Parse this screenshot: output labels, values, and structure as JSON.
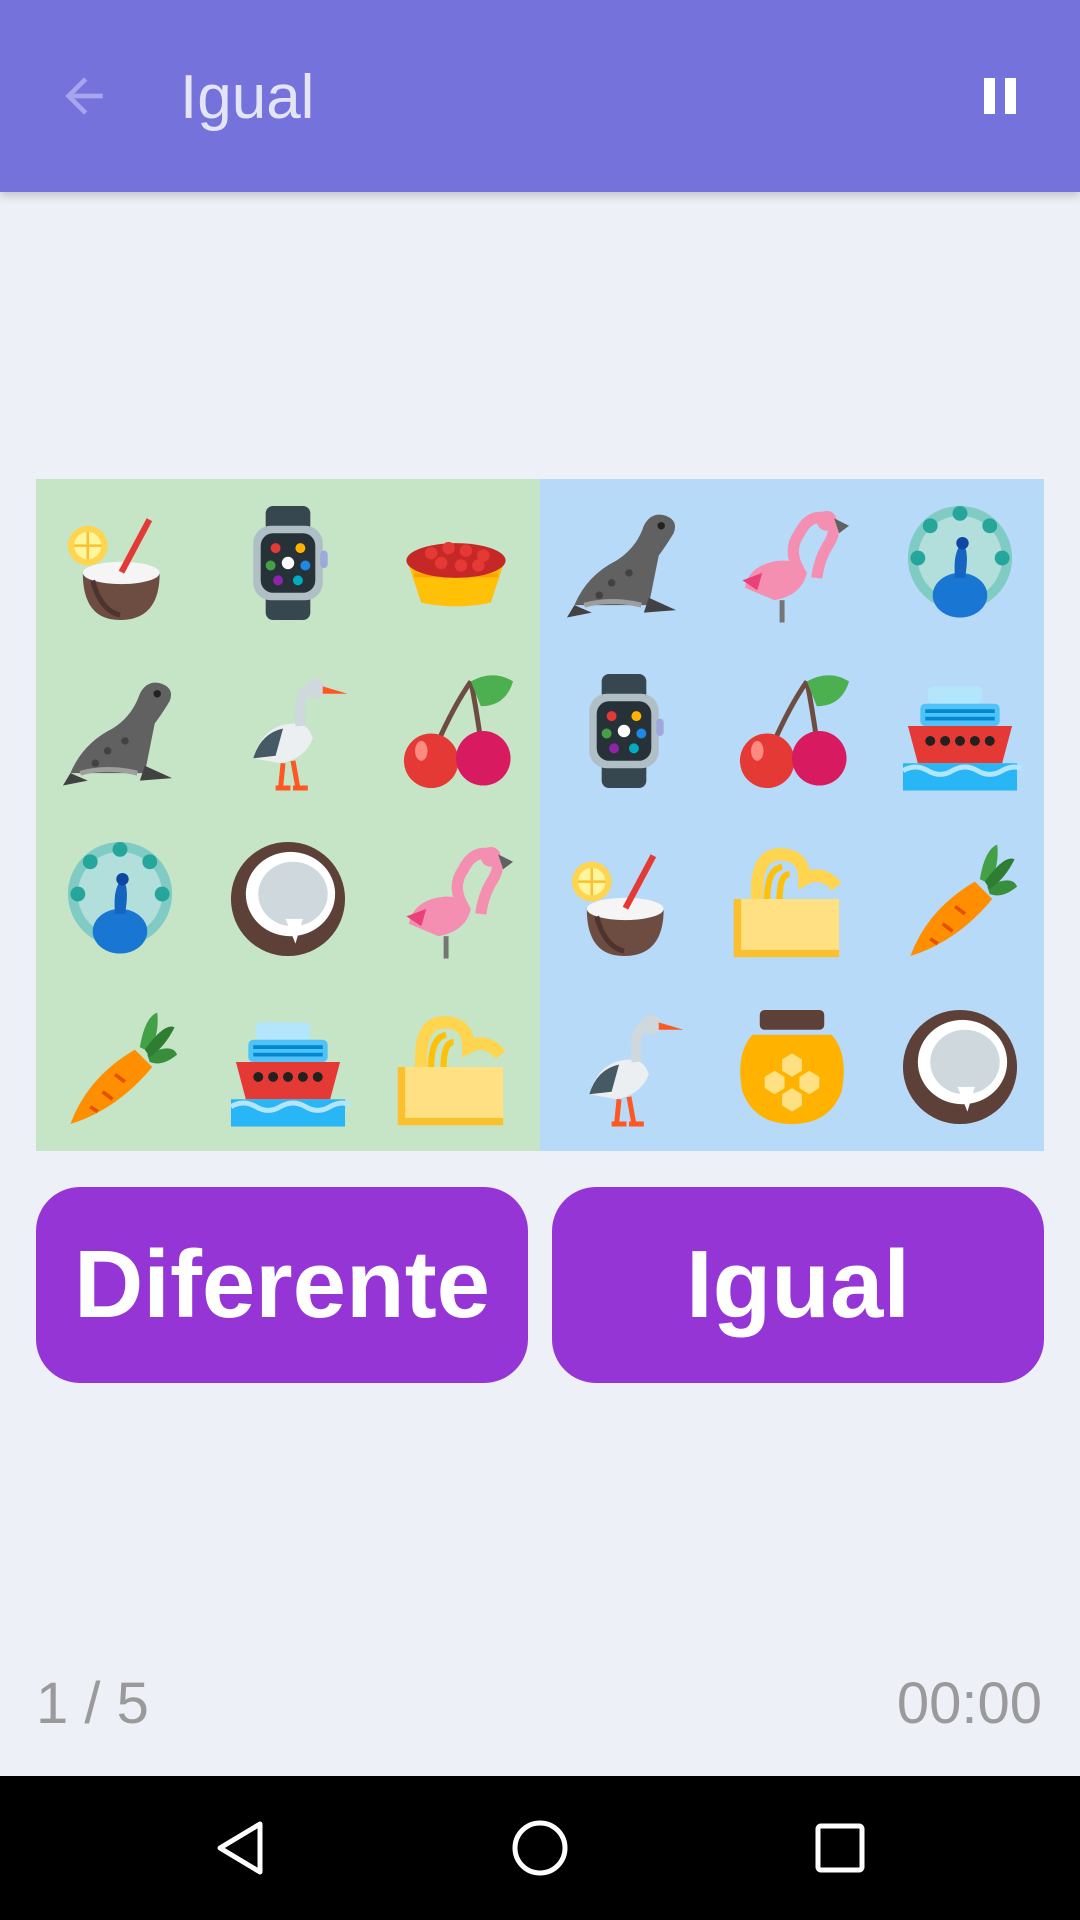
{
  "appbar": {
    "title": "Igual",
    "back_icon": "arrow-back-icon",
    "pause_icon": "pause-icon",
    "color": "#7572DC"
  },
  "boards": {
    "left": {
      "color": "#C6E5C7",
      "items": [
        "coconut-drink",
        "smartwatch",
        "cherry-tart",
        "seal",
        "stork",
        "cherries",
        "peacock",
        "coconut",
        "flamingo",
        "carrot",
        "cruise-ship",
        "butter"
      ]
    },
    "right": {
      "color": "#B6DAF8",
      "items": [
        "seal",
        "flamingo",
        "peacock",
        "smartwatch",
        "cherries",
        "cruise-ship",
        "coconut-drink",
        "butter",
        "carrot",
        "stork",
        "honey-jar",
        "coconut"
      ]
    }
  },
  "buttons": {
    "different_label": "Diferente",
    "same_label": "Igual",
    "color": "#9535D6"
  },
  "footer": {
    "progress": "1 / 5",
    "timer": "00:00"
  },
  "navbar": {
    "back_icon": "triangle-back-icon",
    "home_icon": "circle-home-icon",
    "recents_icon": "square-recents-icon"
  }
}
